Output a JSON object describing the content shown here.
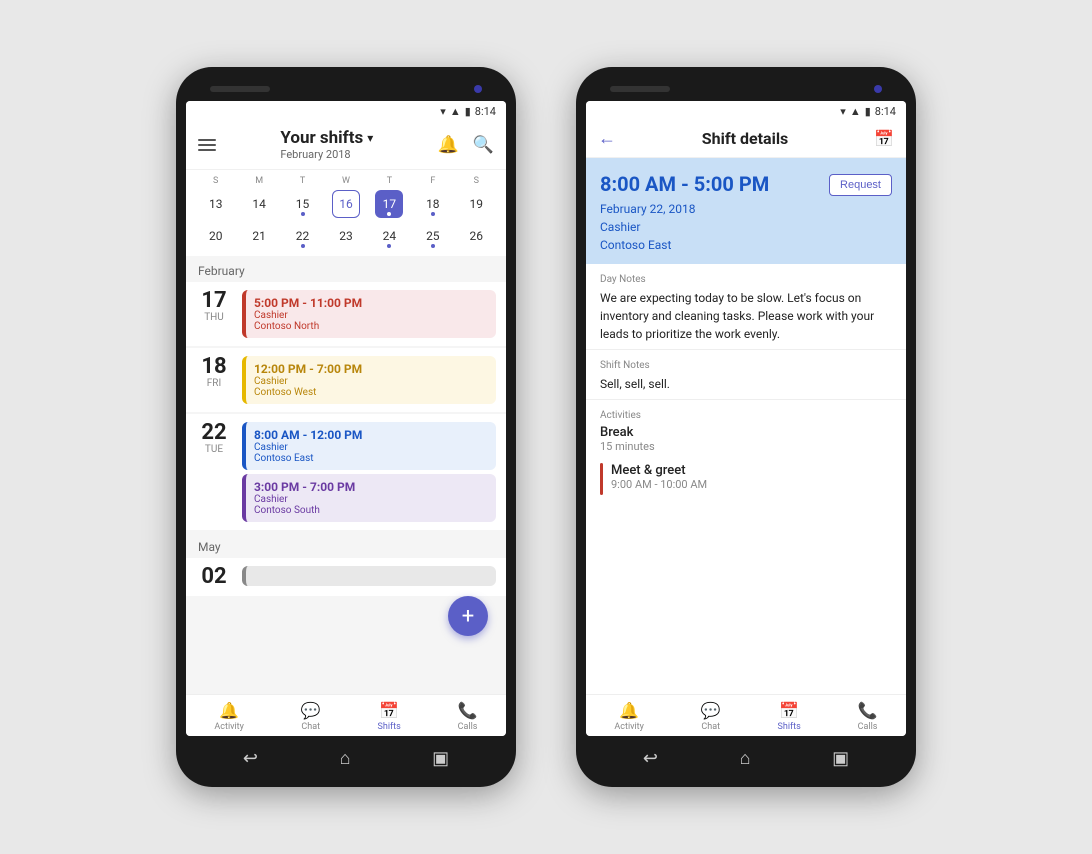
{
  "phone1": {
    "status_time": "8:14",
    "header": {
      "menu_label": "Menu",
      "title": "Your shifts",
      "subtitle": "February 2018",
      "icon1_label": "Shifts icon",
      "icon2_label": "Search icon"
    },
    "week_days": [
      "S",
      "M",
      "T",
      "W",
      "T",
      "F",
      "S"
    ],
    "week1": [
      {
        "num": "13",
        "dot": false,
        "selected": false,
        "outlined": false
      },
      {
        "num": "14",
        "dot": false,
        "selected": false,
        "outlined": false
      },
      {
        "num": "15",
        "dot": true,
        "selected": false,
        "outlined": false
      },
      {
        "num": "16",
        "dot": false,
        "selected": false,
        "outlined": true
      },
      {
        "num": "17",
        "dot": true,
        "selected": true,
        "outlined": false
      },
      {
        "num": "18",
        "dot": true,
        "selected": false,
        "outlined": false
      },
      {
        "num": "19",
        "dot": false,
        "selected": false,
        "outlined": false
      }
    ],
    "week2": [
      {
        "num": "20",
        "dot": false,
        "selected": false,
        "outlined": false
      },
      {
        "num": "21",
        "dot": false,
        "selected": false,
        "outlined": false
      },
      {
        "num": "22",
        "dot": true,
        "selected": false,
        "outlined": false
      },
      {
        "num": "23",
        "dot": false,
        "selected": false,
        "outlined": false
      },
      {
        "num": "24",
        "dot": true,
        "selected": false,
        "outlined": false
      },
      {
        "num": "25",
        "dot": true,
        "selected": false,
        "outlined": false
      },
      {
        "num": "26",
        "dot": false,
        "selected": false,
        "outlined": false
      }
    ],
    "month_labels": [
      "February",
      "May"
    ],
    "shifts": [
      {
        "day_num": "17",
        "day_name": "THU",
        "time": "5:00 PM - 11:00 PM",
        "role": "Cashier",
        "location": "Contoso North",
        "color": "pink"
      },
      {
        "day_num": "18",
        "day_name": "FRI",
        "time": "12:00 PM - 7:00 PM",
        "role": "Cashier",
        "location": "Contoso West",
        "color": "yellow"
      },
      {
        "day_num": "22",
        "day_name": "TUE",
        "time": "8:00 AM - 12:00 PM",
        "role": "Cashier",
        "location": "Contoso East",
        "color": "blue"
      },
      {
        "day_num": "",
        "day_name": "",
        "time": "3:00 PM - 7:00 PM",
        "role": "Cashier",
        "location": "Contoso South",
        "color": "purple"
      }
    ],
    "may_shift": {
      "day_num": "02",
      "day_name": "",
      "color": "gray"
    },
    "bottom_nav": [
      {
        "label": "Activity",
        "icon": "🔔",
        "active": false
      },
      {
        "label": "Chat",
        "icon": "💬",
        "active": false
      },
      {
        "label": "Shifts",
        "icon": "📅",
        "active": true
      },
      {
        "label": "Calls",
        "icon": "📞",
        "active": false
      }
    ]
  },
  "phone2": {
    "status_time": "8:14",
    "header": {
      "back_label": "←",
      "title": "Shift details",
      "icon_label": "Shifts icon"
    },
    "hero": {
      "time": "8:00 AM - 5:00 PM",
      "date": "February 22, 2018",
      "role": "Cashier",
      "location": "Contoso East",
      "request_btn": "Request"
    },
    "day_notes": {
      "label": "Day Notes",
      "text": "We are expecting today to be slow. Let's focus on inventory and cleaning tasks. Please work with your leads to prioritize the work evenly."
    },
    "shift_notes": {
      "label": "Shift Notes",
      "text": "Sell, sell, sell."
    },
    "activities": {
      "label": "Activities",
      "items": [
        {
          "type": "break",
          "name": "Break",
          "sub": "15 minutes",
          "bar_color": null
        },
        {
          "type": "meet",
          "name": "Meet & greet",
          "sub": "9:00 AM - 10:00 AM",
          "bar_color": "#c0392b"
        }
      ]
    },
    "bottom_nav": [
      {
        "label": "Activity",
        "icon": "🔔",
        "active": false
      },
      {
        "label": "Chat",
        "icon": "💬",
        "active": false
      },
      {
        "label": "Shifts",
        "icon": "📅",
        "active": true
      },
      {
        "label": "Calls",
        "icon": "📞",
        "active": false
      }
    ]
  }
}
